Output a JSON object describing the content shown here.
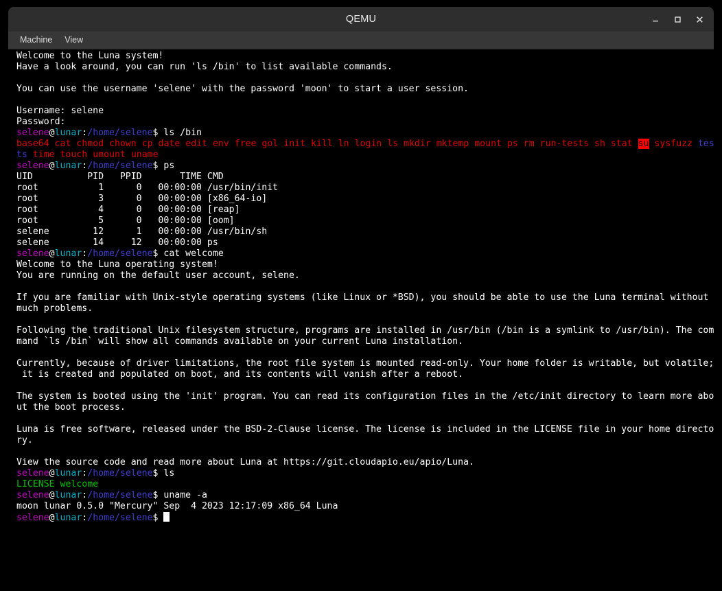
{
  "window": {
    "title": "QEMU",
    "controls": [
      {
        "name": "minimize",
        "glyph": "–"
      },
      {
        "name": "maximize",
        "glyph": "□"
      },
      {
        "name": "close",
        "glyph": "✕"
      }
    ]
  },
  "menubar": {
    "items": [
      {
        "label": "Machine"
      },
      {
        "label": "View"
      }
    ]
  },
  "colors": {
    "background": "#000000",
    "foreground": "#ffffff",
    "titlebar": "#2e2e2e",
    "menubar": "#373737",
    "prompt_user": "#c000c0",
    "prompt_host": "#00b0c4",
    "prompt_path": "#4040d0",
    "executable": "#e00000",
    "directory": "#4040d0",
    "file_green": "#00c000",
    "setuid_bg": "#ff0000"
  },
  "terminal": {
    "prompt": {
      "user": "selene",
      "at": "@",
      "host": "lunar",
      "colon": ":",
      "path": "/home/selene",
      "sigil": "$ "
    },
    "lines": [
      {
        "type": "plain",
        "text": "Welcome to the Luna system!"
      },
      {
        "type": "plain",
        "text": "Have a look around, you can run 'ls /bin' to list available commands."
      },
      {
        "type": "plain",
        "text": ""
      },
      {
        "type": "plain",
        "text": "You can use the username 'selene' with the password 'moon' to start a user session."
      },
      {
        "type": "plain",
        "text": ""
      },
      {
        "type": "plain",
        "text": "Username: selene"
      },
      {
        "type": "plain",
        "text": "Password:"
      },
      {
        "type": "prompt",
        "command": "ls /bin"
      },
      {
        "type": "ls_bin",
        "row": 1
      },
      {
        "type": "ls_bin",
        "row": 2
      },
      {
        "type": "prompt",
        "command": "ps"
      },
      {
        "type": "plain",
        "text": "UID          PID   PPID       TIME CMD"
      },
      {
        "type": "plain",
        "text": "root           1      0   00:00:00 /usr/bin/init"
      },
      {
        "type": "plain",
        "text": "root           3      0   00:00:00 [x86_64-io]"
      },
      {
        "type": "plain",
        "text": "root           4      0   00:00:00 [reap]"
      },
      {
        "type": "plain",
        "text": "root           5      0   00:00:00 [oom]"
      },
      {
        "type": "plain",
        "text": "selene        12      1   00:00:00 /usr/bin/sh"
      },
      {
        "type": "plain",
        "text": "selene        14     12   00:00:00 ps"
      },
      {
        "type": "prompt",
        "command": "cat welcome"
      },
      {
        "type": "plain",
        "text": "Welcome to the Luna operating system!"
      },
      {
        "type": "plain",
        "text": "You are running on the default user account, selene."
      },
      {
        "type": "plain",
        "text": ""
      },
      {
        "type": "plain",
        "text": "If you are familiar with Unix-style operating systems (like Linux or *BSD), you should be able to use the Luna terminal without"
      },
      {
        "type": "plain",
        "text": "much problems."
      },
      {
        "type": "plain",
        "text": ""
      },
      {
        "type": "plain",
        "text": "Following the traditional Unix filesystem structure, programs are installed in /usr/bin (/bin is a symlink to /usr/bin). The com"
      },
      {
        "type": "plain",
        "text": "mand `ls /bin` will show all commands available on your current Luna installation."
      },
      {
        "type": "plain",
        "text": ""
      },
      {
        "type": "plain",
        "text": "Currently, because of driver limitations, the root file system is mounted read-only. Your home folder is writable, but volatile;"
      },
      {
        "type": "plain",
        "text": " it is created and populated on boot, and its contents will vanish after a reboot."
      },
      {
        "type": "plain",
        "text": ""
      },
      {
        "type": "plain",
        "text": "The system is booted using the 'init' program. You can read its configuration files in the /etc/init directory to learn more abo"
      },
      {
        "type": "plain",
        "text": "ut the boot process."
      },
      {
        "type": "plain",
        "text": ""
      },
      {
        "type": "plain",
        "text": "Luna is free software, released under the BSD-2-Clause license. The license is included in the LICENSE file in your home directo"
      },
      {
        "type": "plain",
        "text": "ry."
      },
      {
        "type": "plain",
        "text": ""
      },
      {
        "type": "plain",
        "text": "View the source code and read more about Luna at https://git.cloudapio.eu/apio/Luna."
      },
      {
        "type": "prompt",
        "command": "ls"
      },
      {
        "type": "ls_home"
      },
      {
        "type": "prompt",
        "command": "uname -a"
      },
      {
        "type": "plain",
        "text": "moon lunar 0.5.0 \"Mercury\" Sep  4 2023 12:17:09 x86_64 Luna"
      },
      {
        "type": "prompt_cursor",
        "command": ""
      }
    ],
    "ls_bin_row1": [
      {
        "text": "base64",
        "style": "c-red"
      },
      {
        "text": " ",
        "style": "c-white"
      },
      {
        "text": "cat",
        "style": "c-red"
      },
      {
        "text": " ",
        "style": "c-white"
      },
      {
        "text": "chmod",
        "style": "c-red"
      },
      {
        "text": " ",
        "style": "c-white"
      },
      {
        "text": "chown",
        "style": "c-red"
      },
      {
        "text": " ",
        "style": "c-white"
      },
      {
        "text": "cp",
        "style": "c-red"
      },
      {
        "text": " ",
        "style": "c-white"
      },
      {
        "text": "date",
        "style": "c-red"
      },
      {
        "text": " ",
        "style": "c-white"
      },
      {
        "text": "edit",
        "style": "c-red"
      },
      {
        "text": " ",
        "style": "c-white"
      },
      {
        "text": "env",
        "style": "c-red"
      },
      {
        "text": " ",
        "style": "c-white"
      },
      {
        "text": "free",
        "style": "c-red"
      },
      {
        "text": " ",
        "style": "c-white"
      },
      {
        "text": "gol",
        "style": "c-red"
      },
      {
        "text": " ",
        "style": "c-white"
      },
      {
        "text": "init",
        "style": "c-red"
      },
      {
        "text": " ",
        "style": "c-white"
      },
      {
        "text": "kill",
        "style": "c-red"
      },
      {
        "text": " ",
        "style": "c-white"
      },
      {
        "text": "ln",
        "style": "c-red"
      },
      {
        "text": " ",
        "style": "c-white"
      },
      {
        "text": "login",
        "style": "c-red"
      },
      {
        "text": " ",
        "style": "c-white"
      },
      {
        "text": "ls",
        "style": "c-red"
      },
      {
        "text": " ",
        "style": "c-white"
      },
      {
        "text": "mkdir",
        "style": "c-red"
      },
      {
        "text": " ",
        "style": "c-white"
      },
      {
        "text": "mktemp",
        "style": "c-red"
      },
      {
        "text": " ",
        "style": "c-white"
      },
      {
        "text": "mount",
        "style": "c-red"
      },
      {
        "text": " ",
        "style": "c-white"
      },
      {
        "text": "ps",
        "style": "c-red"
      },
      {
        "text": " ",
        "style": "c-white"
      },
      {
        "text": "rm",
        "style": "c-red"
      },
      {
        "text": " ",
        "style": "c-white"
      },
      {
        "text": "run-tests",
        "style": "c-red"
      },
      {
        "text": " ",
        "style": "c-white"
      },
      {
        "text": "sh",
        "style": "c-red"
      },
      {
        "text": " ",
        "style": "c-white"
      },
      {
        "text": "stat",
        "style": "c-red"
      },
      {
        "text": " ",
        "style": "c-white"
      },
      {
        "text": "su",
        "style": "c-suid"
      },
      {
        "text": " ",
        "style": "c-white"
      },
      {
        "text": "sysfuzz",
        "style": "c-red"
      },
      {
        "text": " ",
        "style": "c-white"
      },
      {
        "text": "tes",
        "style": "c-blue"
      }
    ],
    "ls_bin_row2": [
      {
        "text": "ts",
        "style": "c-blue"
      },
      {
        "text": " ",
        "style": "c-white"
      },
      {
        "text": "time",
        "style": "c-red"
      },
      {
        "text": " ",
        "style": "c-white"
      },
      {
        "text": "touch",
        "style": "c-red"
      },
      {
        "text": " ",
        "style": "c-white"
      },
      {
        "text": "umount",
        "style": "c-red"
      },
      {
        "text": " ",
        "style": "c-white"
      },
      {
        "text": "uname",
        "style": "c-red"
      }
    ],
    "ls_home": [
      {
        "text": "LICENSE",
        "style": "c-green"
      },
      {
        "text": " ",
        "style": "c-white"
      },
      {
        "text": "welcome",
        "style": "c-green"
      }
    ]
  }
}
